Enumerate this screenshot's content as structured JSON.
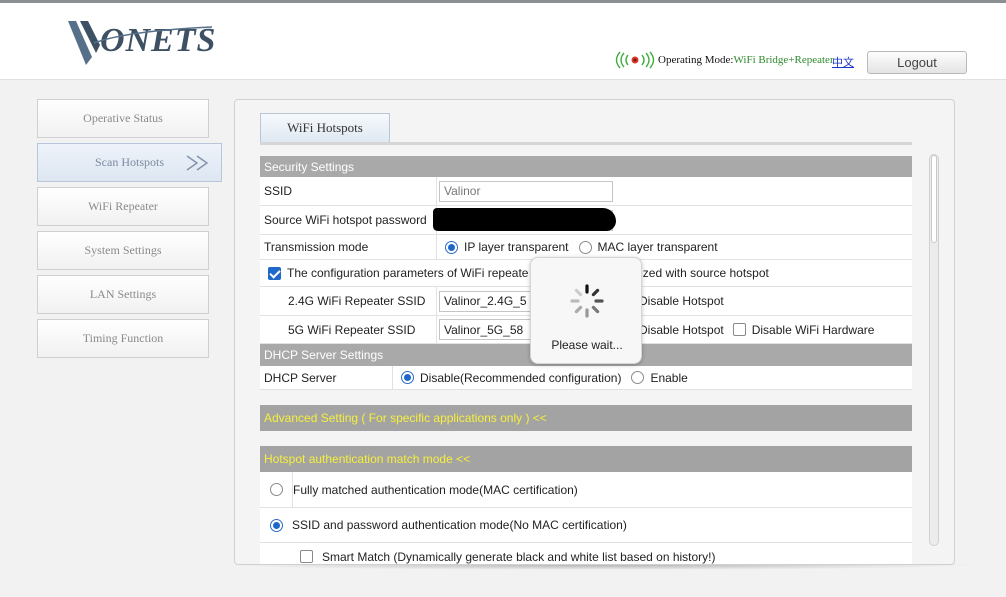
{
  "header": {
    "logo_alt": "VONETS",
    "operating_mode_label": "Operating Mode:",
    "operating_mode_value": "WiFi Bridge+Repeater",
    "language_link": "中文",
    "logout_label": "Logout"
  },
  "sidebar": {
    "items": [
      {
        "label": "Operative Status"
      },
      {
        "label": "Scan Hotspots",
        "active": true
      },
      {
        "label": "WiFi Repeater"
      },
      {
        "label": "System Settings"
      },
      {
        "label": "LAN Settings"
      },
      {
        "label": "Timing Function"
      }
    ]
  },
  "main": {
    "tab_label": "WiFi Hotspots",
    "security": {
      "heading": "Security Settings",
      "ssid_label": "SSID",
      "ssid_value": "Valinor",
      "password_label": "Source WiFi hotspot password",
      "transmission_label": "Transmission mode",
      "transmission_options": [
        "IP layer transparent",
        "MAC layer transparent"
      ],
      "transmission_selected": "IP layer transparent",
      "sync_text_left": "The configuration parameters of WiFi repeate",
      "sync_text_right": "nized with source hotspot",
      "sync_checked": true,
      "ssid24_label": "2.4G WiFi Repeater SSID",
      "ssid24_value": "Valinor_2.4G_5",
      "ssid5_label": "5G WiFi Repeater SSID",
      "ssid5_value": "Valinor_5G_58",
      "disable_hotspot_label": "Disable Hotspot",
      "disable_hardware_label": "Disable WiFi Hardware"
    },
    "dhcp": {
      "heading": "DHCP Server Settings",
      "label": "DHCP Server",
      "options": [
        "Disable(Recommended configuration)",
        "Enable"
      ],
      "selected": "Disable(Recommended configuration)"
    },
    "advanced_heading": "Advanced Setting ( For specific applications only ) <<",
    "auth": {
      "heading": "Hotspot authentication match mode <<",
      "option_full": "Fully matched authentication mode(MAC certification)",
      "option_ssid": "SSID and password authentication mode(No MAC certification)",
      "selected": "option_ssid",
      "smart_match": "Smart Match (Dynamically generate black and white list based on history!)"
    }
  },
  "popup": {
    "message": "Please wait..."
  },
  "colors": {
    "section_bg": "#a9a9a9",
    "section_yellow_text": "#f6ef3c",
    "accent_blue": "#1f67c9",
    "mode_value_green": "#2e8b2e"
  }
}
